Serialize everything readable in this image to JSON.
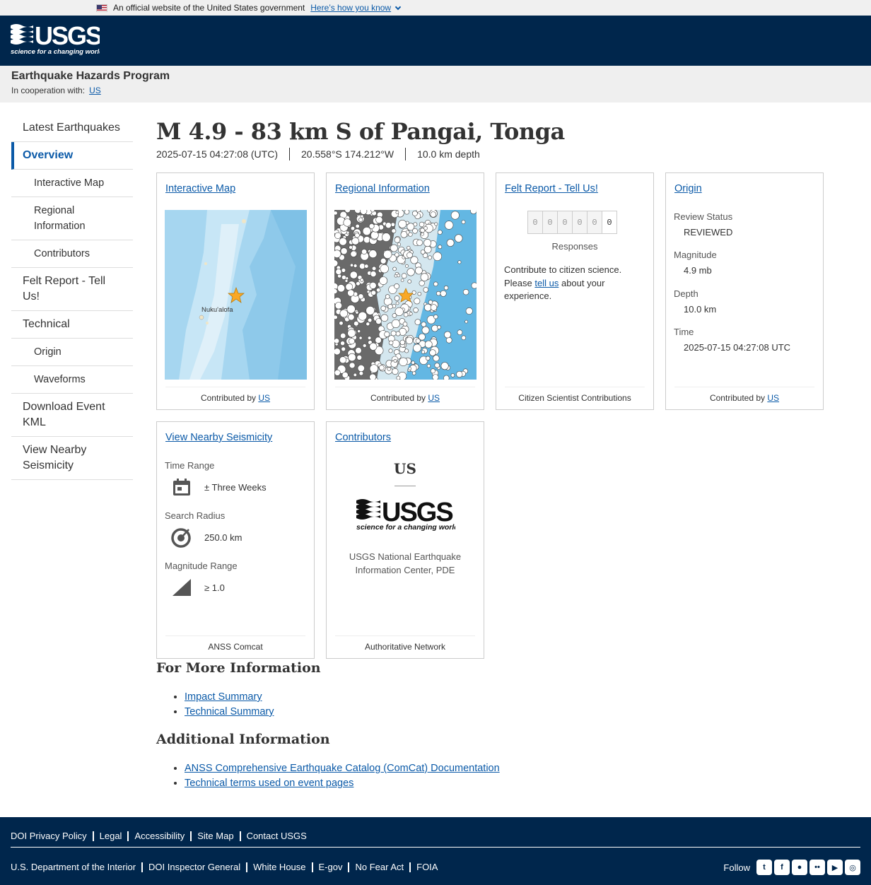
{
  "gov_banner": {
    "text": "An official website of the United States government",
    "link": "Here’s how you know"
  },
  "header": {
    "logo_alt": "USGS science for a changing world"
  },
  "program": {
    "title": "Earthquake Hazards Program",
    "coop_label": "In cooperation with:",
    "coop_link": "US"
  },
  "sidebar": {
    "items": [
      {
        "label": "Latest Earthquakes"
      },
      {
        "label": "Overview"
      },
      {
        "label": "Interactive Map"
      },
      {
        "label": "Regional Information"
      },
      {
        "label": "Contributors"
      },
      {
        "label": "Felt Report - Tell Us!"
      },
      {
        "label": "Technical"
      },
      {
        "label": "Origin"
      },
      {
        "label": "Waveforms"
      },
      {
        "label": "Download Event KML"
      },
      {
        "label": "View Nearby Seismicity"
      }
    ]
  },
  "event": {
    "title": "M 4.9 - 83 km S of Pangai, Tonga",
    "time": "2025-07-15 04:27:08 (UTC)",
    "location": "20.558°S 174.212°W",
    "depth": "10.0 km depth"
  },
  "cards": {
    "map": {
      "title": "Interactive Map",
      "place_label": "Nuku'alofa",
      "footer_prefix": "Contributed by",
      "footer_link": "US"
    },
    "regional": {
      "title": "Regional Information",
      "footer_prefix": "Contributed by",
      "footer_link": "US"
    },
    "felt": {
      "title": "Felt Report - Tell Us!",
      "digits": [
        "0",
        "0",
        "0",
        "0",
        "0",
        "0"
      ],
      "responses_label": "Responses",
      "text_before": "Contribute to citizen science. Please",
      "text_link": "tell us",
      "text_after": "about your experience.",
      "footer": "Citizen Scientist Contributions"
    },
    "origin": {
      "title": "Origin",
      "review_label": "Review Status",
      "review_value": "REVIEWED",
      "magnitude_label": "Magnitude",
      "magnitude_value": "4.9 mb",
      "depth_label": "Depth",
      "depth_value": "10.0 km",
      "time_label": "Time",
      "time_value": "2025-07-15 04:27:08 UTC",
      "footer_prefix": "Contributed by",
      "footer_link": "US"
    },
    "seismicity": {
      "title": "View Nearby Seismicity",
      "time_label": "Time Range",
      "time_value": "± Three Weeks",
      "radius_label": "Search Radius",
      "radius_value": "250.0 km",
      "mag_label": "Magnitude Range",
      "mag_value": "≥ 1.0",
      "footer": "ANSS Comcat"
    },
    "contributors": {
      "title": "Contributors",
      "code": "US",
      "name": "USGS National Earthquake Information Center, PDE",
      "footer": "Authoritative Network"
    }
  },
  "more_info": {
    "heading": "For More Information",
    "links": [
      "Impact Summary",
      "Technical Summary"
    ]
  },
  "additional_info": {
    "heading": "Additional Information",
    "links": [
      "ANSS Comprehensive Earthquake Catalog (ComCat) Documentation",
      "Technical terms used on event pages"
    ]
  },
  "footer": {
    "row1": [
      "DOI Privacy Policy",
      "Legal",
      "Accessibility",
      "Site Map",
      "Contact USGS"
    ],
    "row2": [
      "U.S. Department of the Interior",
      "DOI Inspector General",
      "White House",
      "E-gov",
      "No Fear Act",
      "FOIA"
    ],
    "follow_label": "Follow",
    "social_icons": [
      "twitter-icon",
      "facebook-icon",
      "github-icon",
      "flickr-icon",
      "youtube-icon",
      "instagram-icon"
    ]
  }
}
